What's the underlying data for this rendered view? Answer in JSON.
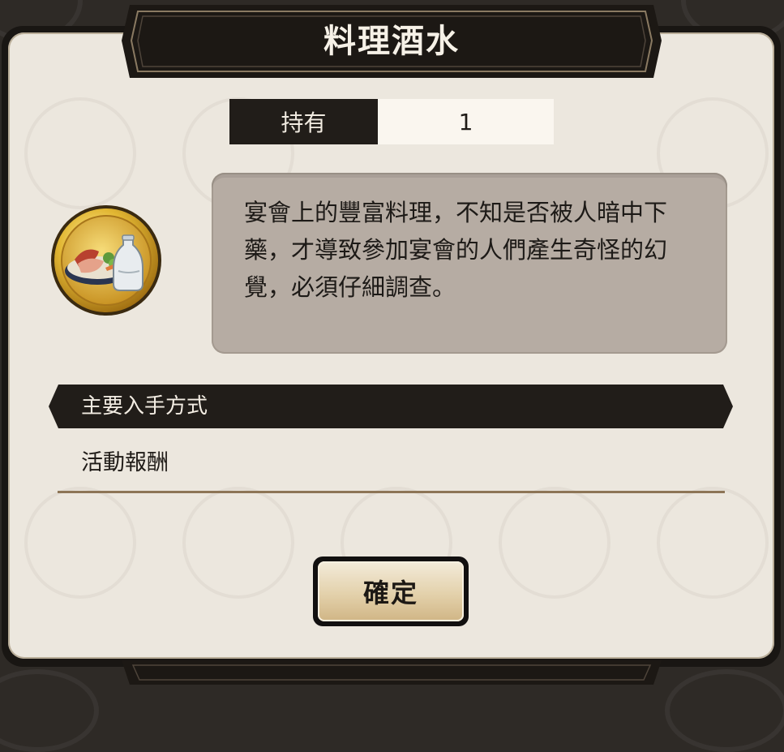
{
  "dialog": {
    "title": "料理酒水",
    "owned": {
      "label": "持有",
      "value": "1"
    },
    "item": {
      "icon": "dish-and-sake-bottle-icon",
      "description": "宴會上的豐富料理，不知是否被人暗中下藥，才導致參加宴會的人們產生奇怪的幻覺，必須仔細調查。"
    },
    "acquisition": {
      "header": "主要入手方式",
      "source": "活動報酬"
    },
    "confirm_label": "確定"
  },
  "colors": {
    "dark_plate": "#211d19",
    "panel_bg": "#ece7de",
    "description_bg": "#b6aca3",
    "icon_gold": "#d9a825",
    "divider": "#8d7556"
  }
}
